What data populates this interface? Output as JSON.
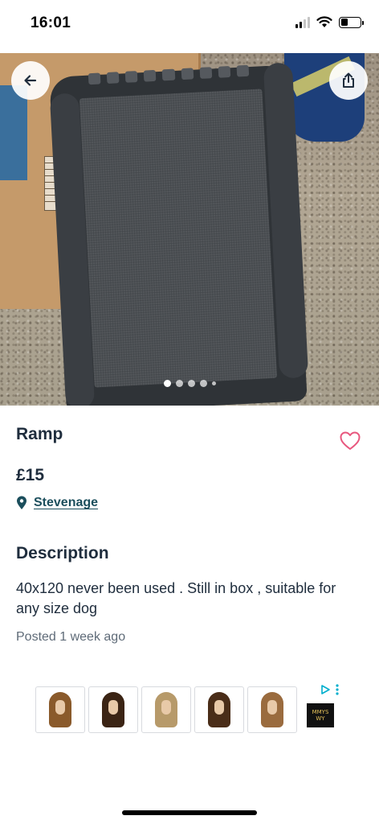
{
  "status_bar": {
    "time": "16:01",
    "battery_level": 0.35
  },
  "hero": {
    "image_count": 5,
    "active_index": 0,
    "back_icon": "arrow-left-icon",
    "share_icon": "share-icon"
  },
  "listing": {
    "title": "Ramp",
    "price": "£15",
    "location": "Stevenage",
    "favourite_icon": "heart-outline-icon"
  },
  "description": {
    "heading": "Description",
    "body": "40x120 never been used . Still in box , suitable for any size dog",
    "posted": "Posted 1 week ago"
  },
  "ad": {
    "brand_logo_text": "MMYS WY",
    "adchoices_icon": "adchoices-icon",
    "more_icon": "more-vertical-icon",
    "items": [
      {
        "hair": "#8a5a2b"
      },
      {
        "hair": "#3b2414"
      },
      {
        "hair": "#b79a6a"
      },
      {
        "hair": "#4a2d18"
      },
      {
        "hair": "#9a6b3e"
      }
    ]
  },
  "colors": {
    "accent_heart": "#e8577e",
    "location_link": "#1b4e5c",
    "text": "#1f2d3d",
    "muted": "#5f6b78"
  }
}
